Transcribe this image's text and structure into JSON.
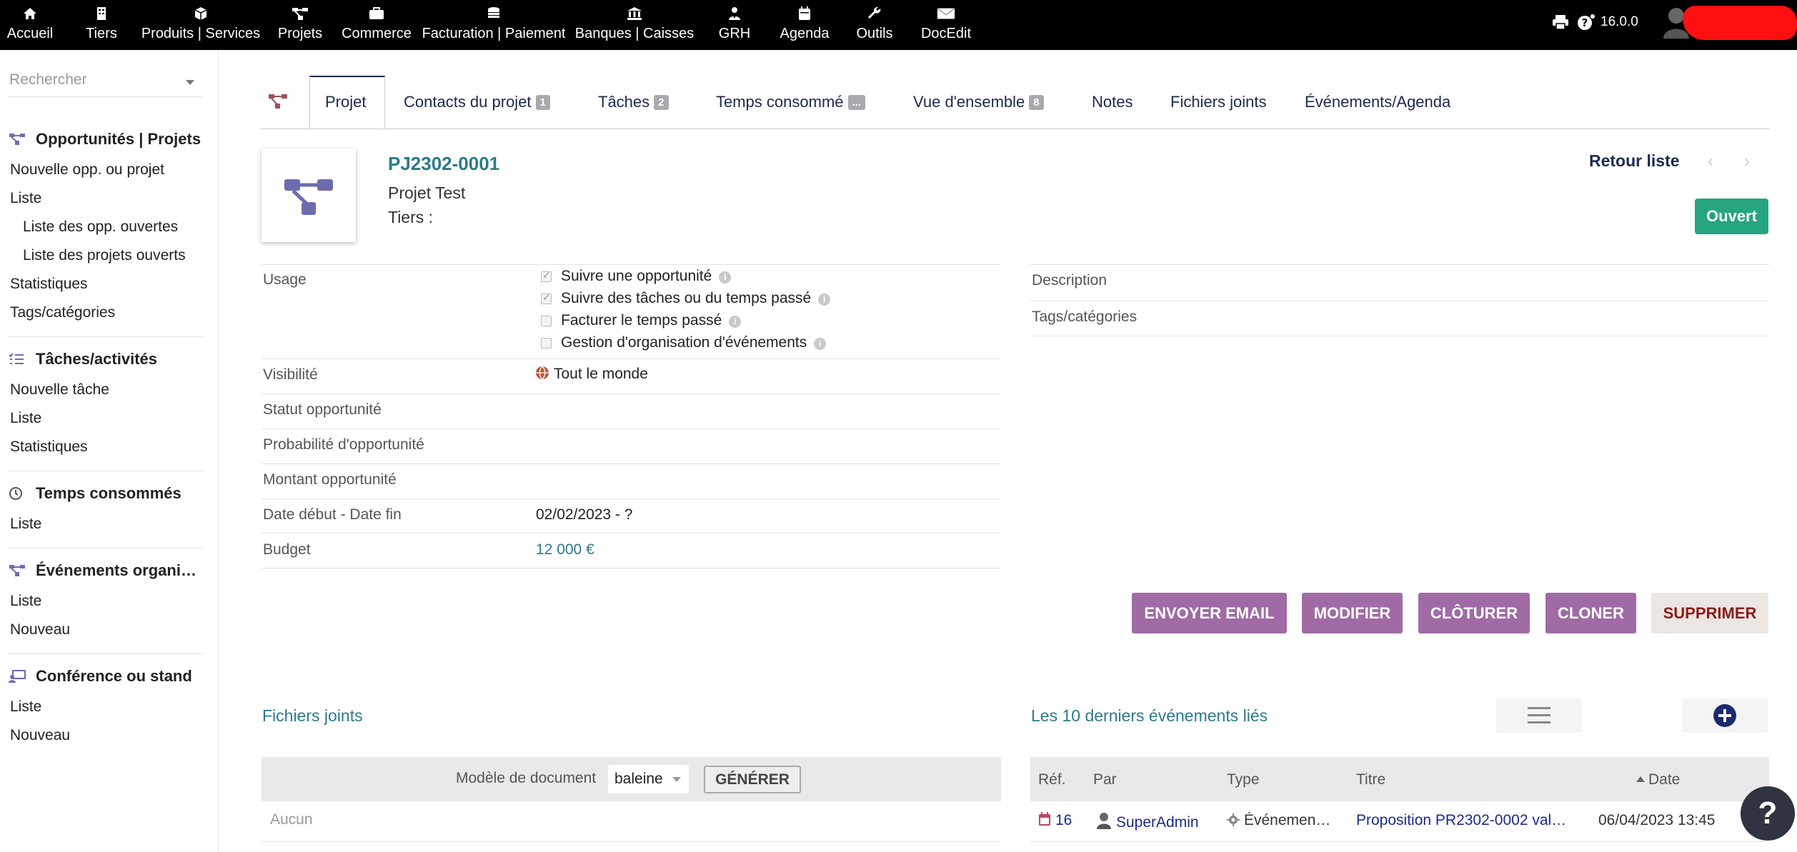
{
  "topnav": {
    "items": [
      {
        "label": "Accueil",
        "icon": "home-icon"
      },
      {
        "label": "Tiers",
        "icon": "building-icon"
      },
      {
        "label": "Produits | Services",
        "icon": "cube-icon"
      },
      {
        "label": "Projets",
        "icon": "project-icon"
      },
      {
        "label": "Commerce",
        "icon": "briefcase-icon"
      },
      {
        "label": "Facturation | Paiement",
        "icon": "coins-icon"
      },
      {
        "label": "Banques | Caisses",
        "icon": "bank-icon"
      },
      {
        "label": "GRH",
        "icon": "user-tie-icon"
      },
      {
        "label": "Agenda",
        "icon": "calendar-icon"
      },
      {
        "label": "Outils",
        "icon": "wrench-icon"
      },
      {
        "label": "DocEdit",
        "icon": "mail-icon"
      }
    ],
    "version": "16.0.0"
  },
  "sidebar": {
    "search_placeholder": "Rechercher",
    "sections": [
      {
        "title": "Opportunités | Projets",
        "items": [
          "Nouvelle opp. ou projet",
          "Liste",
          "Liste des opp. ouvertes",
          "Liste des projets ouverts",
          "Statistiques",
          "Tags/catégories"
        ]
      },
      {
        "title": "Tâches/activités",
        "items": [
          "Nouvelle tâche",
          "Liste",
          "Statistiques"
        ]
      },
      {
        "title": "Temps consommés",
        "items": [
          "Liste"
        ]
      },
      {
        "title": "Événements organi…",
        "items": [
          "Liste",
          "Nouveau"
        ]
      },
      {
        "title": "Conférence ou stand",
        "items": [
          "Liste",
          "Nouveau"
        ]
      }
    ]
  },
  "tabs": [
    {
      "label": "Projet",
      "badge": ""
    },
    {
      "label": "Contacts du projet",
      "badge": "1"
    },
    {
      "label": "Tâches",
      "badge": "2"
    },
    {
      "label": "Temps consommé",
      "badge": "..."
    },
    {
      "label": "Vue d'ensemble",
      "badge": "8"
    },
    {
      "label": "Notes",
      "badge": ""
    },
    {
      "label": "Fichiers joints",
      "badge": ""
    },
    {
      "label": "Événements/Agenda",
      "badge": ""
    }
  ],
  "header": {
    "ref": "PJ2302-0001",
    "name": "Projet Test",
    "tiers_label": "Tiers :",
    "back_link": "Retour liste",
    "status": "Ouvert"
  },
  "fields": {
    "usage_label": "Usage",
    "usage_options": [
      {
        "label": "Suivre une opportunité",
        "checked": true
      },
      {
        "label": "Suivre des tâches ou du temps passé",
        "checked": true
      },
      {
        "label": "Facturer le temps passé",
        "checked": false
      },
      {
        "label": "Gestion d'organisation d'événements",
        "checked": false
      }
    ],
    "visibility_label": "Visibilité",
    "visibility_value": "Tout le monde",
    "statut_label": "Statut opportunité",
    "proba_label": "Probabilité d'opportunité",
    "montant_label": "Montant opportunité",
    "dates_label": "Date début - Date fin",
    "dates_value": "02/02/2023 - ?",
    "budget_label": "Budget",
    "budget_value": "12 000 €",
    "description_label": "Description",
    "tags_label": "Tags/catégories"
  },
  "actions": [
    "ENVOYER EMAIL",
    "MODIFIER",
    "CLÔTURER",
    "CLONER",
    "SUPPRIMER"
  ],
  "files": {
    "title": "Fichiers joints",
    "model_label": "Modèle de document",
    "model_value": "baleine",
    "generate": "GÉNÉRER",
    "empty": "Aucun"
  },
  "events": {
    "title": "Les 10 derniers événements liés",
    "columns": [
      "Réf.",
      "Par",
      "Type",
      "Titre",
      "Date"
    ],
    "rows": [
      {
        "ref": "16",
        "by": "SuperAdmin",
        "type": "Événemen…",
        "title": "Proposition PR2302-0002 val…",
        "date": "06/04/2023 13:45"
      }
    ]
  },
  "colors": {
    "accent": "#a06ba5",
    "topbar": "#000000",
    "status_green": "#25a580",
    "title_teal": "#2b7a8c"
  }
}
